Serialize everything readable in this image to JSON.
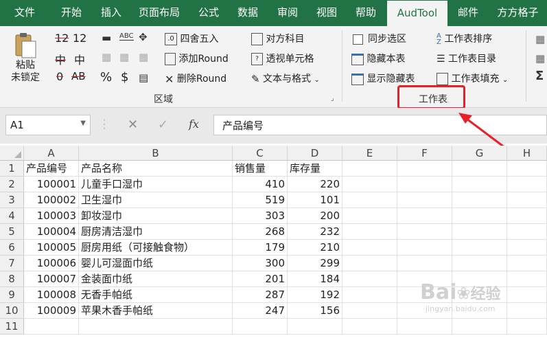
{
  "tabs": [
    {
      "label": "文件",
      "active": false
    },
    {
      "label": "开始",
      "active": false
    },
    {
      "label": "插入",
      "active": false
    },
    {
      "label": "页面布局",
      "active": false
    },
    {
      "label": "公式",
      "active": false
    },
    {
      "label": "数据",
      "active": false
    },
    {
      "label": "审阅",
      "active": false
    },
    {
      "label": "视图",
      "active": false
    },
    {
      "label": "帮助",
      "active": false
    },
    {
      "label": "AudTool",
      "active": true
    },
    {
      "label": "邮件",
      "active": false
    },
    {
      "label": "方方格子",
      "active": false
    }
  ],
  "ribbon": {
    "paste_label_1": "粘贴",
    "paste_label_2": "未锁定",
    "num_12_a": "12",
    "num_12_b": "12",
    "zhong_a": "中",
    "zhong_b": "中",
    "zero": "0",
    "ab": "AB",
    "percent": "%",
    "dollar": "$",
    "round4": "四舍五入",
    "add_round": "添加Round",
    "del_round": "删除Round",
    "dui_fang": "对方科目",
    "tou_shi": "透视单元格",
    "wen_ben": "文本与格式",
    "region_label": "区域",
    "sync_select": "同步选区",
    "hide_sheet": "隐藏本表",
    "show_hidden": "显示隐藏表",
    "sheet_sort": "工作表排序",
    "sheet_dir": "工作表目录",
    "sheet_fill": "工作表填充",
    "sheet_group_label": "工作表"
  },
  "formula_bar": {
    "name_box": "A1",
    "fx": "fx",
    "content": "产品编号"
  },
  "columns": [
    "A",
    "B",
    "C",
    "D",
    "E",
    "F",
    "G",
    "H"
  ],
  "rows": [
    {
      "n": "1",
      "a": "产品编号",
      "b": "产品名称",
      "c": "销售量",
      "d": "库存量"
    },
    {
      "n": "2",
      "a": "100001",
      "b": "儿童手口湿巾",
      "c": "410",
      "d": "220"
    },
    {
      "n": "3",
      "a": "100002",
      "b": "卫生湿巾",
      "c": "519",
      "d": "101"
    },
    {
      "n": "4",
      "a": "100003",
      "b": "卸妆湿巾",
      "c": "303",
      "d": "200"
    },
    {
      "n": "5",
      "a": "100004",
      "b": "厨房清洁湿巾",
      "c": "268",
      "d": "232"
    },
    {
      "n": "6",
      "a": "100005",
      "b": "厨房用纸（可接触食物）",
      "c": "179",
      "d": "210"
    },
    {
      "n": "7",
      "a": "100006",
      "b": "婴儿可湿面巾纸",
      "c": "300",
      "d": "299"
    },
    {
      "n": "8",
      "a": "100007",
      "b": "金装面巾纸",
      "c": "201",
      "d": "184"
    },
    {
      "n": "9",
      "a": "100008",
      "b": "无香手帕纸",
      "c": "287",
      "d": "192"
    },
    {
      "n": "10",
      "a": "100009",
      "b": "苹果木香手帕纸",
      "c": "247",
      "d": "156"
    },
    {
      "n": "11",
      "a": "",
      "b": "",
      "c": "",
      "d": ""
    }
  ],
  "colors": {
    "excel_green": "#217346",
    "highlight": "#e8202a"
  },
  "watermark": {
    "brand": "Bai",
    "brand2": "经验",
    "url": "jingyan.baidu.com"
  }
}
